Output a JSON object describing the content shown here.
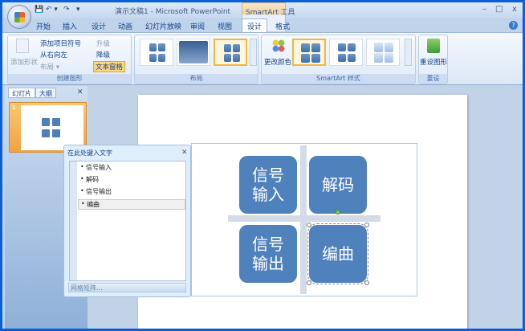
{
  "window": {
    "title": "演示文稿1 - Microsoft PowerPoint",
    "context_tab_group": "SmartArt 工具",
    "minimize": "–",
    "maximize": "□",
    "close": "x",
    "qa_save": "💾",
    "qa_undo": "↶ ▾",
    "qa_redo": "↷",
    "qa_more": "▾"
  },
  "tabs": [
    "开始",
    "插入",
    "设计",
    "动画",
    "幻灯片放映",
    "审阅",
    "视图",
    "设计",
    "格式"
  ],
  "active_tab": "设计",
  "help": "?",
  "ribbon": {
    "create_group": {
      "label": "创建图形",
      "add_shape": "添加形状",
      "add_bullet": "添加项目符号",
      "rtl": "从右向左",
      "layout": "布局 ▾",
      "promote": "升级",
      "demote": "降级",
      "text_pane": "文本窗格"
    },
    "layout_group": {
      "label": "布局"
    },
    "styles_group": {
      "label": "SmartArt 样式",
      "change_colors": "更改颜色"
    },
    "reset_group": {
      "label": "重设",
      "reset_graphic": "重设图形"
    }
  },
  "side_panel": {
    "tab_slides": "幻灯片",
    "tab_outline": "大纲",
    "close": "✕",
    "slide_number": "1"
  },
  "text_pane": {
    "title": "在此处键入文字",
    "close": "✕",
    "items": [
      "信号输入",
      "解码",
      "信号输出",
      "编曲"
    ],
    "footer": "网格矩阵..."
  },
  "smartart": {
    "boxes": [
      "信号\n输入",
      "解码",
      "信号\n输出",
      "编曲"
    ]
  },
  "colors": {
    "box": "#4f81bd",
    "accent": "#f0b840"
  }
}
